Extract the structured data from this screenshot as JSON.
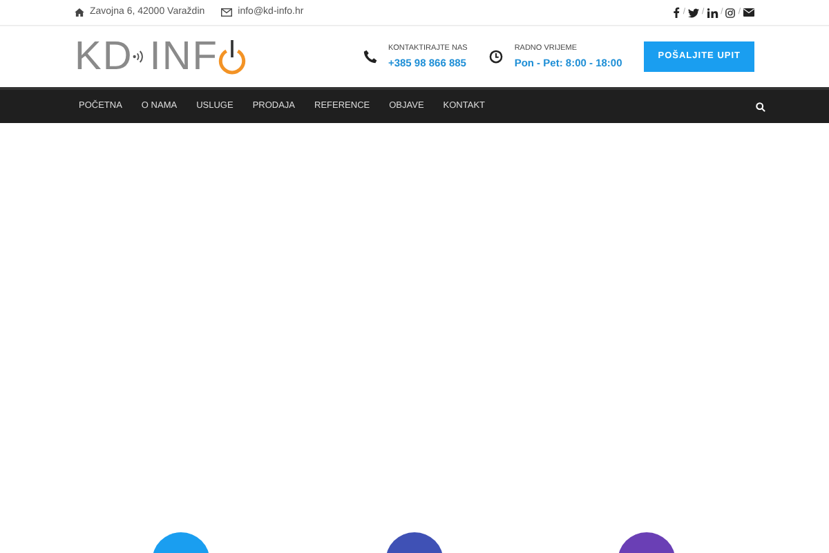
{
  "top_bar": {
    "address": "Zavojna 6, 42000 Varaždin",
    "email": "info@kd-info.hr",
    "social": [
      {
        "kind": "facebook"
      },
      {
        "kind": "twitter"
      },
      {
        "kind": "linkedin"
      },
      {
        "kind": "instagram"
      },
      {
        "kind": "mail"
      }
    ],
    "separator": "/"
  },
  "header": {
    "logo": {
      "left": "KD",
      "right": "INF"
    },
    "contact": [
      {
        "kind": "phone",
        "label": "KONTAKTIRAJTE NAS",
        "value": "+385 98 866 885"
      },
      {
        "kind": "clock",
        "label": "RADNO VRIJEME",
        "value": "Pon - Pet: 8:00 - 18:00"
      }
    ],
    "button": "POŠALJITE UPIT"
  },
  "nav": {
    "items": [
      "POČETNA",
      "O NAMA",
      "USLUGE",
      "PRODAJA",
      "REFERENCE",
      "OBJAVE",
      "KONTAKT"
    ]
  },
  "features": [
    {
      "color": "#1a9ef0"
    },
    {
      "color": "#3f51b5"
    },
    {
      "color": "#6a3fb5"
    }
  ]
}
